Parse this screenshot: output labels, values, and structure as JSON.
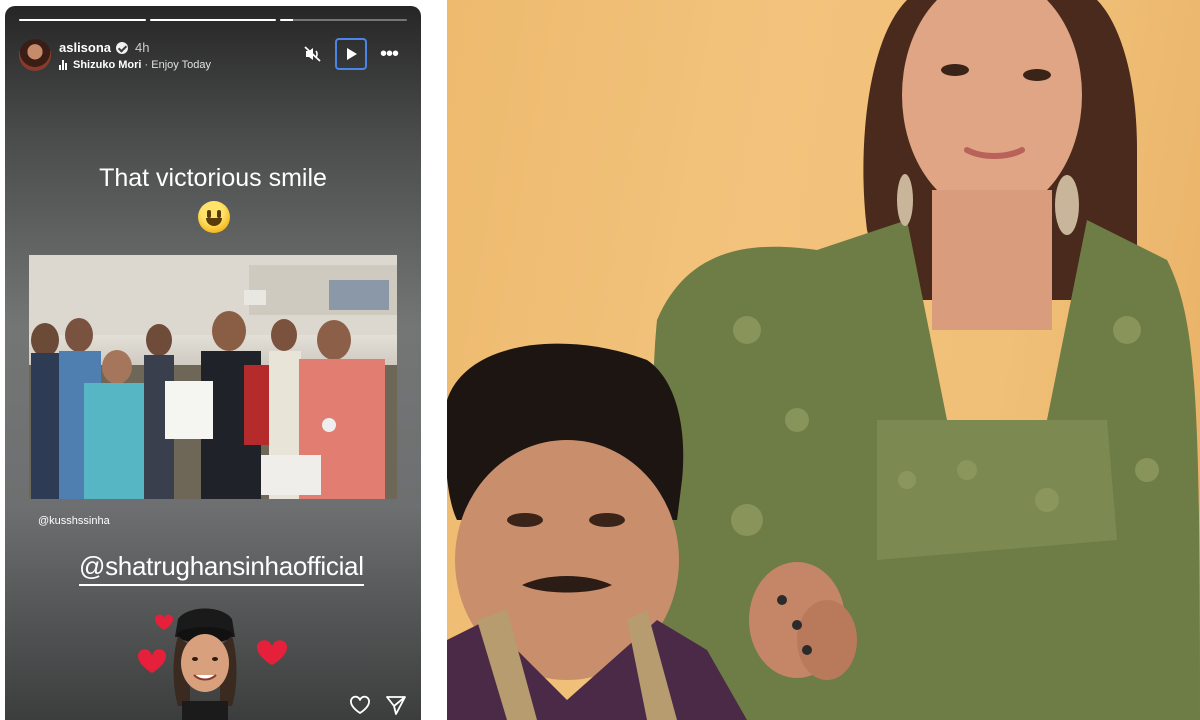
{
  "story": {
    "username": "aslisona",
    "time_ago": "4h",
    "music": {
      "artist": "Shizuko Mori",
      "separator": "·",
      "track": "Enjoy Today"
    },
    "progress": [
      1,
      1,
      0.1
    ],
    "caption": "That victorious smile",
    "mention_small": "@kusshssinha",
    "mention_big": "@shatrughansinhaofficial"
  },
  "icons": {
    "mute": "muted-speaker-icon",
    "play": "play-icon",
    "more": "more-options-icon",
    "like": "heart-outline-icon",
    "share": "send-icon"
  },
  "colors": {
    "play_focus": "#4a86e8",
    "heart": "#e6203a"
  }
}
